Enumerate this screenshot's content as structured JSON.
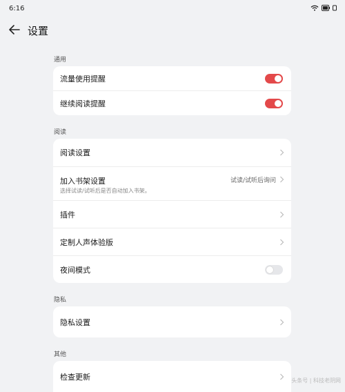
{
  "status_bar": {
    "time": "6:16"
  },
  "header": {
    "title": "设置"
  },
  "sections": {
    "general": {
      "label": "通用",
      "items": [
        {
          "label": "流量使用提醒",
          "toggle": "on"
        },
        {
          "label": "继续阅读提醒",
          "toggle": "on"
        }
      ]
    },
    "reading": {
      "label": "阅读",
      "items": [
        {
          "label": "阅读设置"
        },
        {
          "label": "加入书架设置",
          "value": "试读/试听后询问",
          "sub": "选择试读/试听后是否自动加入书架。"
        },
        {
          "label": "插件"
        },
        {
          "label": "定制人声体验版"
        },
        {
          "label": "夜间模式",
          "toggle": "off"
        }
      ]
    },
    "privacy": {
      "label": "隐私",
      "items": [
        {
          "label": "隐私设置"
        }
      ]
    },
    "other": {
      "label": "其他",
      "items": [
        {
          "label": "检查更新"
        }
      ]
    }
  },
  "watermark": "头条号 | 科技老阴网"
}
